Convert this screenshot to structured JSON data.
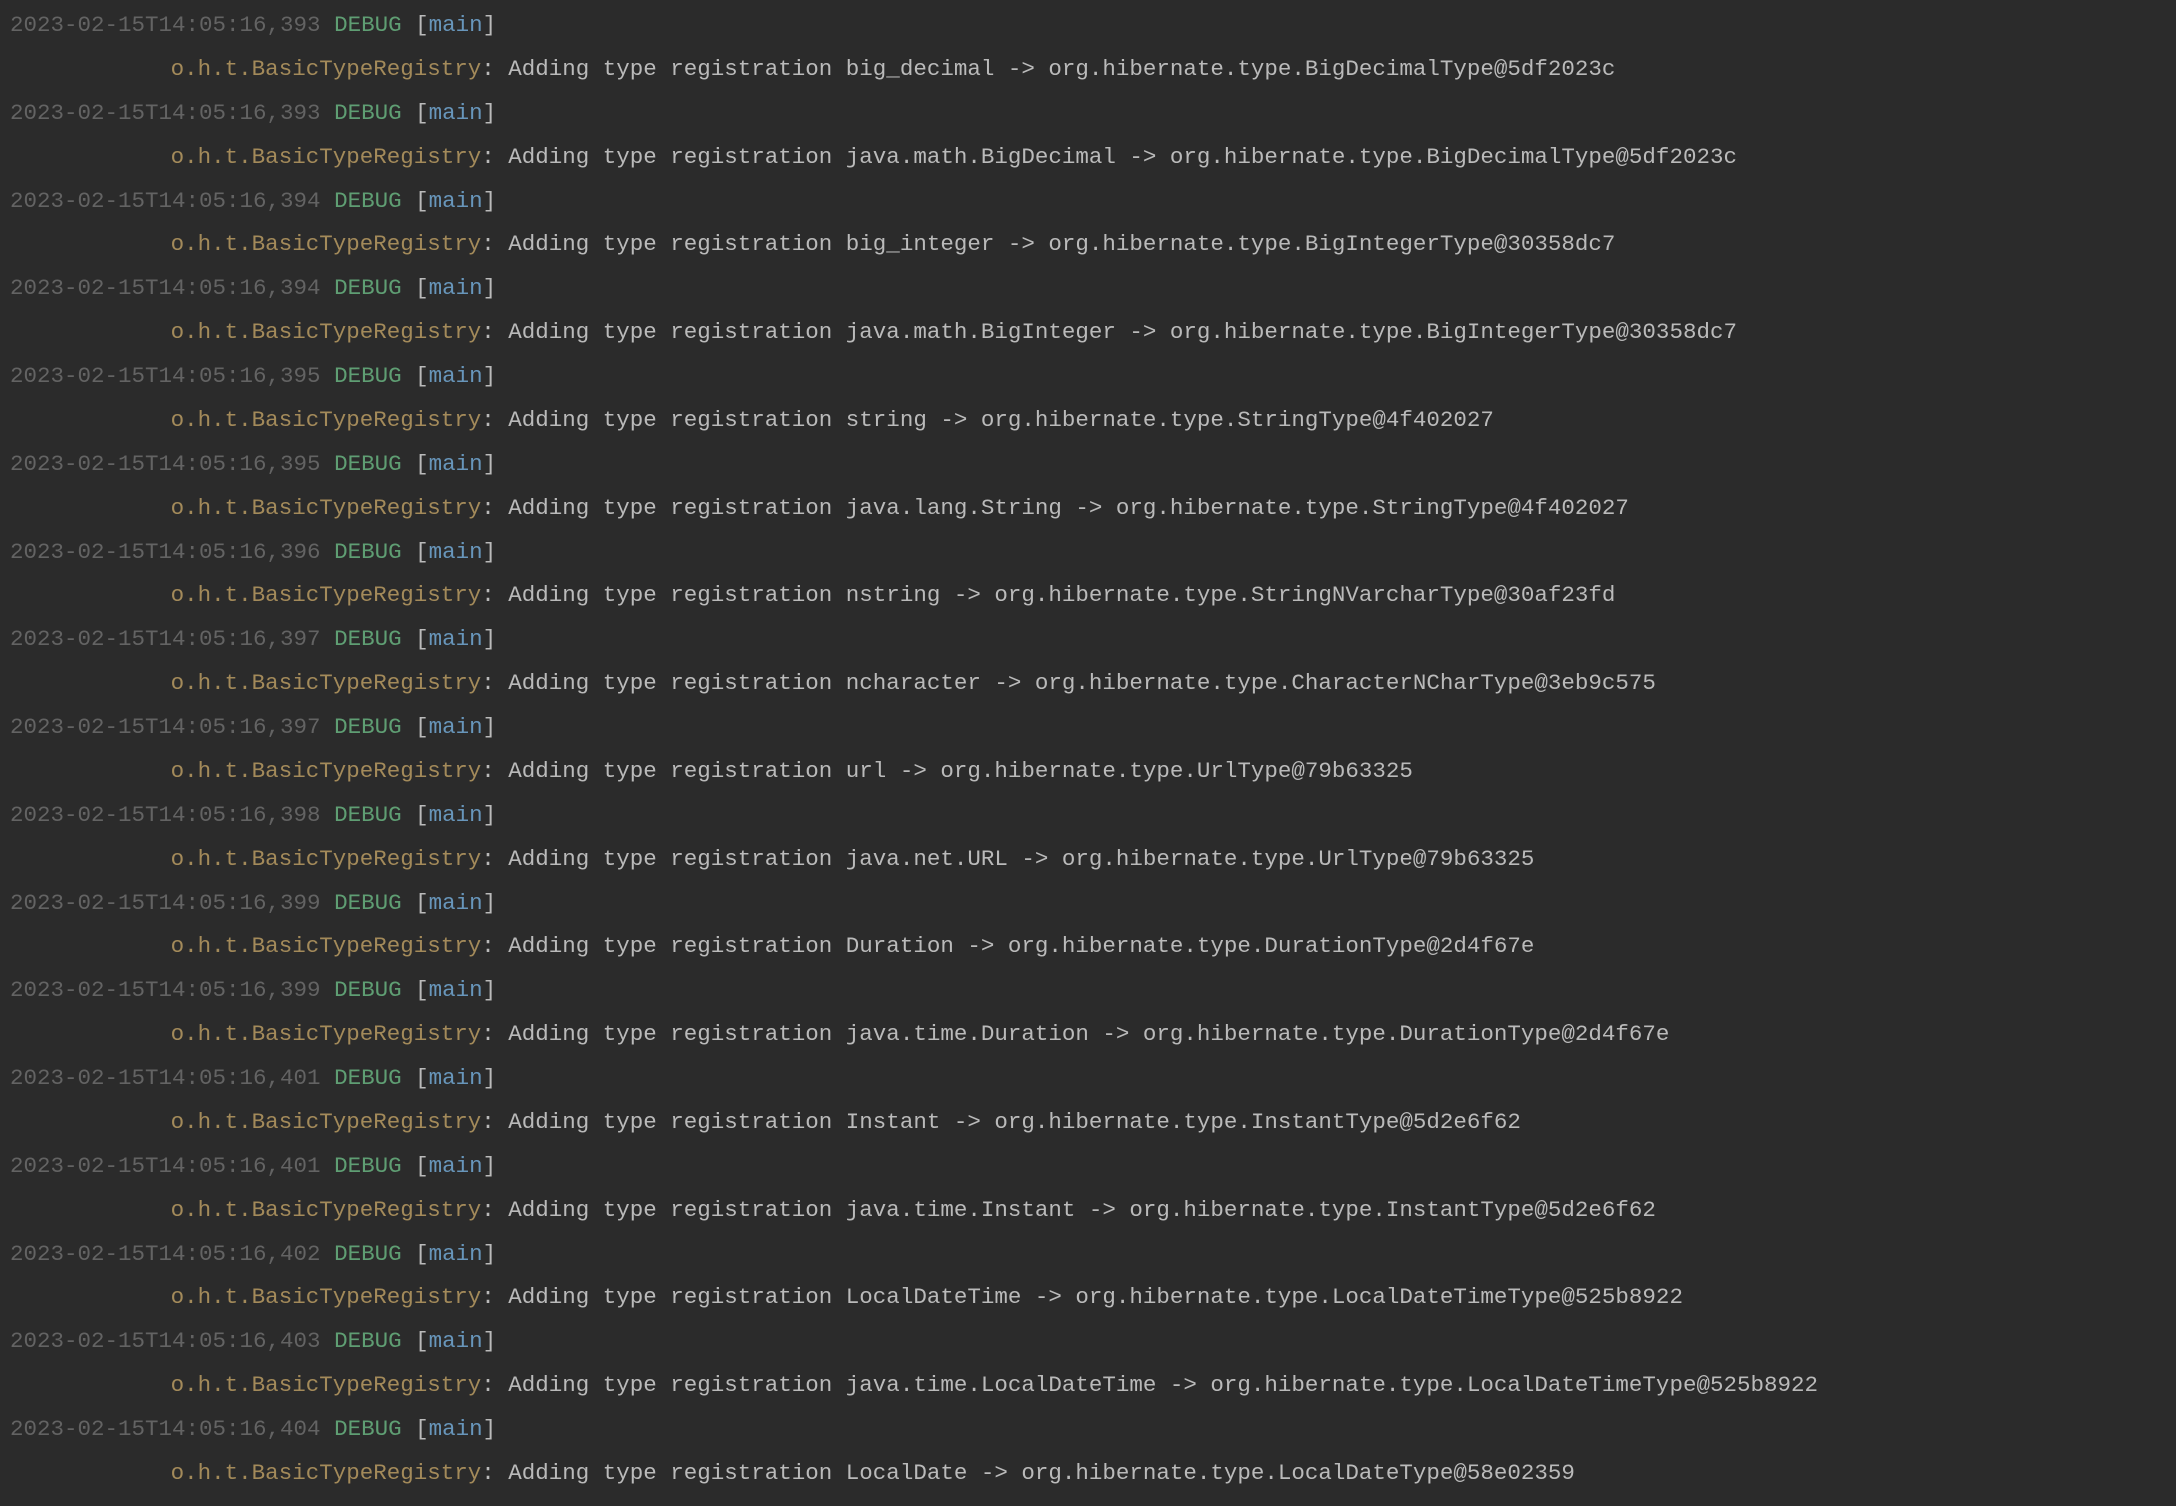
{
  "logs": [
    {
      "timestamp": "2023-02-15T14:05:16,393",
      "level": "DEBUG",
      "thread": "main",
      "logger": "o.h.t.BasicTypeRegistry",
      "message": "Adding type registration big_decimal -> org.hibernate.type.BigDecimalType@5df2023c"
    },
    {
      "timestamp": "2023-02-15T14:05:16,393",
      "level": "DEBUG",
      "thread": "main",
      "logger": "o.h.t.BasicTypeRegistry",
      "message": "Adding type registration java.math.BigDecimal -> org.hibernate.type.BigDecimalType@5df2023c"
    },
    {
      "timestamp": "2023-02-15T14:05:16,394",
      "level": "DEBUG",
      "thread": "main",
      "logger": "o.h.t.BasicTypeRegistry",
      "message": "Adding type registration big_integer -> org.hibernate.type.BigIntegerType@30358dc7"
    },
    {
      "timestamp": "2023-02-15T14:05:16,394",
      "level": "DEBUG",
      "thread": "main",
      "logger": "o.h.t.BasicTypeRegistry",
      "message": "Adding type registration java.math.BigInteger -> org.hibernate.type.BigIntegerType@30358dc7"
    },
    {
      "timestamp": "2023-02-15T14:05:16,395",
      "level": "DEBUG",
      "thread": "main",
      "logger": "o.h.t.BasicTypeRegistry",
      "message": "Adding type registration string -> org.hibernate.type.StringType@4f402027"
    },
    {
      "timestamp": "2023-02-15T14:05:16,395",
      "level": "DEBUG",
      "thread": "main",
      "logger": "o.h.t.BasicTypeRegistry",
      "message": "Adding type registration java.lang.String -> org.hibernate.type.StringType@4f402027"
    },
    {
      "timestamp": "2023-02-15T14:05:16,396",
      "level": "DEBUG",
      "thread": "main",
      "logger": "o.h.t.BasicTypeRegistry",
      "message": "Adding type registration nstring -> org.hibernate.type.StringNVarcharType@30af23fd"
    },
    {
      "timestamp": "2023-02-15T14:05:16,397",
      "level": "DEBUG",
      "thread": "main",
      "logger": "o.h.t.BasicTypeRegistry",
      "message": "Adding type registration ncharacter -> org.hibernate.type.CharacterNCharType@3eb9c575"
    },
    {
      "timestamp": "2023-02-15T14:05:16,397",
      "level": "DEBUG",
      "thread": "main",
      "logger": "o.h.t.BasicTypeRegistry",
      "message": "Adding type registration url -> org.hibernate.type.UrlType@79b63325"
    },
    {
      "timestamp": "2023-02-15T14:05:16,398",
      "level": "DEBUG",
      "thread": "main",
      "logger": "o.h.t.BasicTypeRegistry",
      "message": "Adding type registration java.net.URL -> org.hibernate.type.UrlType@79b63325"
    },
    {
      "timestamp": "2023-02-15T14:05:16,399",
      "level": "DEBUG",
      "thread": "main",
      "logger": "o.h.t.BasicTypeRegistry",
      "message": "Adding type registration Duration -> org.hibernate.type.DurationType@2d4f67e"
    },
    {
      "timestamp": "2023-02-15T14:05:16,399",
      "level": "DEBUG",
      "thread": "main",
      "logger": "o.h.t.BasicTypeRegistry",
      "message": "Adding type registration java.time.Duration -> org.hibernate.type.DurationType@2d4f67e"
    },
    {
      "timestamp": "2023-02-15T14:05:16,401",
      "level": "DEBUG",
      "thread": "main",
      "logger": "o.h.t.BasicTypeRegistry",
      "message": "Adding type registration Instant -> org.hibernate.type.InstantType@5d2e6f62"
    },
    {
      "timestamp": "2023-02-15T14:05:16,401",
      "level": "DEBUG",
      "thread": "main",
      "logger": "o.h.t.BasicTypeRegistry",
      "message": "Adding type registration java.time.Instant -> org.hibernate.type.InstantType@5d2e6f62"
    },
    {
      "timestamp": "2023-02-15T14:05:16,402",
      "level": "DEBUG",
      "thread": "main",
      "logger": "o.h.t.BasicTypeRegistry",
      "message": "Adding type registration LocalDateTime -> org.hibernate.type.LocalDateTimeType@525b8922"
    },
    {
      "timestamp": "2023-02-15T14:05:16,403",
      "level": "DEBUG",
      "thread": "main",
      "logger": "o.h.t.BasicTypeRegistry",
      "message": "Adding type registration java.time.LocalDateTime -> org.hibernate.type.LocalDateTimeType@525b8922"
    },
    {
      "timestamp": "2023-02-15T14:05:16,404",
      "level": "DEBUG",
      "thread": "main",
      "logger": "o.h.t.BasicTypeRegistry",
      "message": "Adding type registration LocalDate -> org.hibernate.type.LocalDateType@58e02359"
    }
  ]
}
